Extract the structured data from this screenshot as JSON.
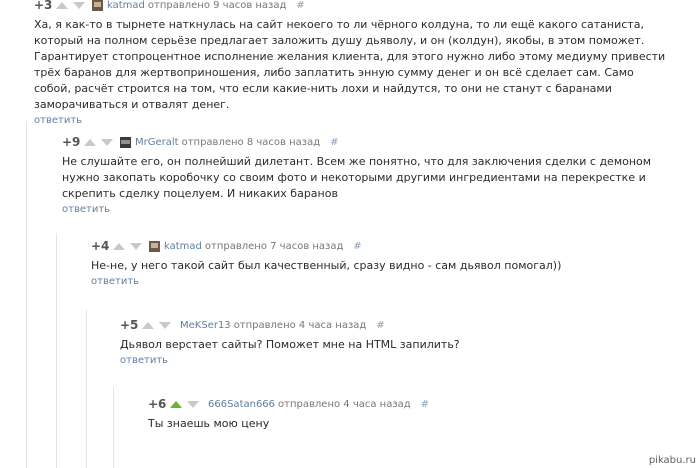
{
  "comments": [
    {
      "rating": "+3",
      "author": "katmad",
      "meta": "отправлено 9 часов назад",
      "hash": "#",
      "upvoted": false,
      "avatar": "avatar-image",
      "text": "Ха, я как-то в тырнете наткнулась на сайт некоего то ли чёрного колдуна, то ли ещё какого сатаниста, который на полном серьёзе предлагает заложить душу дьяволу, и он (колдун), якобы, в этом поможет. Гарантирует стопроцентное исполнение желания клиента, для этого нужно либо этому медиуму привести трёх баранов для жертвоприношения, либо заплатить энную сумму денег и он всё сделает сам. Само собой, расчёт строится на том, что если какие-нить лохи и найдутся, то они не станут с баранами заморачиваться и отвалят денег.",
      "reply": "ответить"
    },
    {
      "rating": "+9",
      "author": "MrGeralt",
      "meta": "отправлено 8 часов назад",
      "hash": "#",
      "upvoted": false,
      "avatar": "avatar-image",
      "text": "Не слушайте его, он полнейший дилетант. Всем же понятно, что для заключения сделки с демоном нужно закопать коробочку со своим фото и некоторыми другими ингредиентами на перекрестке и скрепить сделку поцелуем. И никаких баранов",
      "reply": "ответить"
    },
    {
      "rating": "+4",
      "author": "katmad",
      "meta": "отправлено 7 часов назад",
      "hash": "#",
      "upvoted": false,
      "avatar": "avatar-image",
      "text": "Не-не, у него такой сайт был качественный, сразу видно - сам дьявол помогал))",
      "reply": "ответить"
    },
    {
      "rating": "+5",
      "author": "MeKSer13",
      "meta": "отправлено 4 часа назад",
      "hash": "#",
      "upvoted": false,
      "avatar": "",
      "text": "Дьявол верстает сайты? Поможет мне на HTML запилить?",
      "reply": "ответить"
    },
    {
      "rating": "+6",
      "author": "666Satan666",
      "meta": "отправлено 4 часа назад",
      "hash": "#",
      "upvoted": true,
      "avatar": "",
      "text": "Ты знаешь мою цену",
      "reply": ""
    }
  ],
  "watermark": "pikabu.ru",
  "colors": {
    "link": "#5f7fa0",
    "upvote_active": "#6ab22c",
    "arrow_idle": "#c9c9c9",
    "thread_line": "#e4e4e4"
  }
}
